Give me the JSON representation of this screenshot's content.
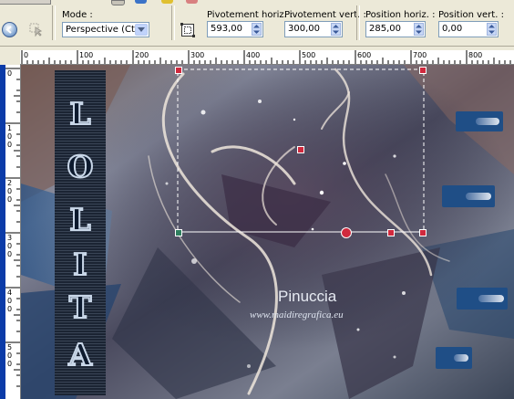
{
  "toolbar": {
    "mode_label": "Mode :",
    "mode_value": "Perspective (Ctrl)",
    "fields": [
      {
        "label": "Pivotement horiz. :",
        "value": "593,00"
      },
      {
        "label": "Pivotement vert. :",
        "value": "300,00"
      },
      {
        "label": "Position horiz. :",
        "value": "285,00"
      },
      {
        "label": "Position vert. :",
        "value": "0,00"
      }
    ]
  },
  "ruler": {
    "top_ticks": [
      "0",
      "100",
      "200",
      "300",
      "400",
      "500",
      "600",
      "700",
      "800"
    ],
    "left_ticks": [
      "0",
      "100",
      "200",
      "300",
      "400",
      "500"
    ]
  },
  "canvas": {
    "side_letters": [
      "L",
      "O",
      "L",
      "I",
      "T",
      "A"
    ],
    "signature_name": "Pinuccia",
    "signature_url": "www.maidiregrafica.eu"
  },
  "colors": {
    "accent_blue": "#1f4e86",
    "handle_red": "#d0293d",
    "toolbar_bg": "#ece9d8",
    "ruler_edge": "#0b3ba8"
  },
  "icons": [
    "back-arrow-icon",
    "pick-tool-icon",
    "dropdown-arrow-icon",
    "frame-icon",
    "spin-arrows-icon"
  ]
}
